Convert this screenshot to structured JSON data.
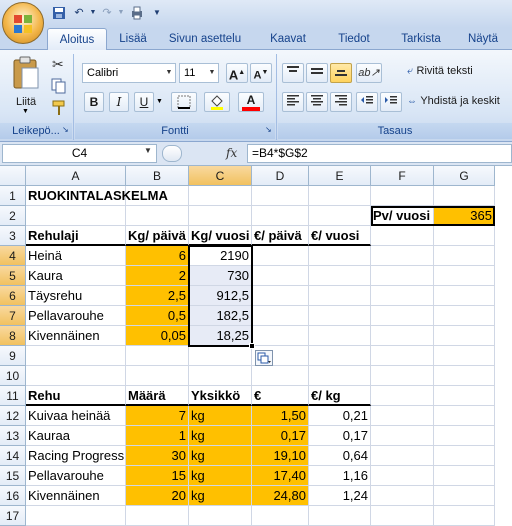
{
  "ribbon": {
    "tabs": [
      "Aloitus",
      "Lisää",
      "Sivun asettelu",
      "Kaavat",
      "Tiedot",
      "Tarkista",
      "Näytä"
    ],
    "active_tab": "Aloitus",
    "paste_label": "Liitä",
    "clipboard_group": "Leikepö...",
    "font_group": "Fontti",
    "align_group": "Tasaus",
    "font_name": "Calibri",
    "font_size": "11",
    "grow_font": "A",
    "shrink_font": "A",
    "bold": "B",
    "italic": "I",
    "underline": "U",
    "font_color": "A",
    "wrap_text": "Rivitä teksti",
    "merge_center": "Yhdistä ja keskit"
  },
  "formula_bar": {
    "name_box": "C4",
    "fx": "fx",
    "formula": "=B4*$G$2"
  },
  "columns": [
    "A",
    "B",
    "C",
    "D",
    "E",
    "F",
    "G"
  ],
  "rows": [
    "1",
    "2",
    "3",
    "4",
    "5",
    "6",
    "7",
    "8",
    "9",
    "10",
    "11",
    "12",
    "13",
    "14",
    "15",
    "16",
    "17"
  ],
  "cells": {
    "A1": "RUOKINTALASKELMA",
    "F2": "Pv/ vuosi",
    "G2": "365",
    "A3": "Rehulaji",
    "B3": "Kg/ päivä",
    "C3": "Kg/ vuosi",
    "D3": "€/ päivä",
    "E3": "€/ vuosi",
    "A4": "Heinä",
    "B4": "6",
    "C4": "2190",
    "A5": "Kaura",
    "B5": "2",
    "C5": "730",
    "A6": "Täysrehu",
    "B6": "2,5",
    "C6": "912,5",
    "A7": "Pellavarouhe",
    "B7": "0,5",
    "C7": "182,5",
    "A8": "Kivennäinen",
    "B8": "0,05",
    "C8": "18,25",
    "A11": "Rehu",
    "B11": "Määrä",
    "C11": "Yksikkö",
    "D11": "€",
    "E11": "€/ kg",
    "A12": "Kuivaa heinää",
    "B12": "7",
    "C12": "kg",
    "D12": "1,50",
    "E12": "0,21",
    "A13": "Kauraa",
    "B13": "1",
    "C13": "kg",
    "D13": "0,17",
    "E13": "0,17",
    "A14": "Racing Progress",
    "B14": "30",
    "C14": "kg",
    "D14": "19,10",
    "E14": "0,64",
    "A15": "Pellavarouhe",
    "B15": "15",
    "C15": "kg",
    "D15": "17,40",
    "E15": "1,16",
    "A16": "Kivennäinen",
    "B16": "20",
    "C16": "kg",
    "D16": "24,80",
    "E16": "1,24"
  },
  "colors": {
    "highlight": "#ffc000",
    "selection": "#e7ebf6",
    "ribbon": "#d8e5f5"
  },
  "icons": [
    "office-button-icon",
    "save-icon",
    "undo-icon",
    "redo-icon",
    "print-icon",
    "paste-icon",
    "cut-icon",
    "copy-icon",
    "format-painter-icon",
    "paste-options-icon"
  ]
}
